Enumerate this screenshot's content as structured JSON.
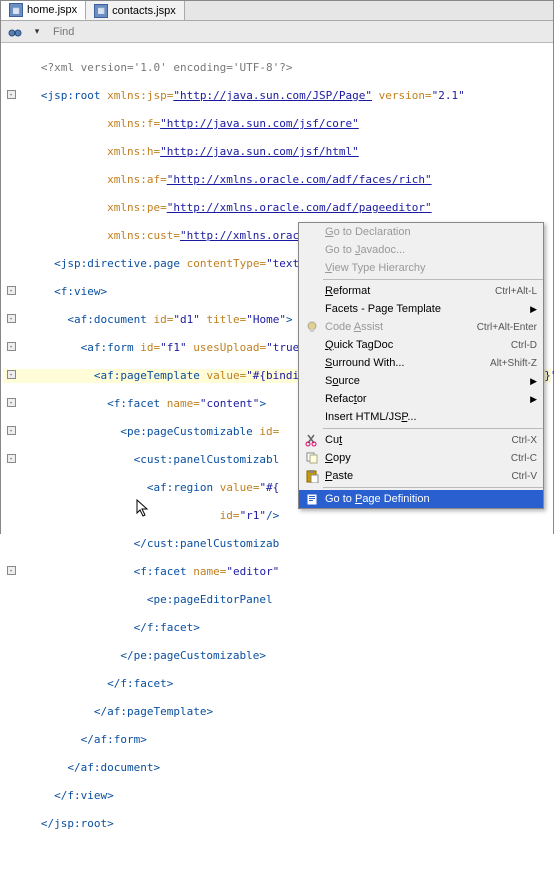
{
  "tabs": {
    "items": [
      "home.jspx",
      "contacts.jspx"
    ],
    "active": 0
  },
  "find": {
    "placeholder": "Find"
  },
  "code": {
    "l1": "<?xml version='1.0' encoding='UTF-8'?>",
    "l2a": "<jsp:root",
    "l2b": " xmlns:jsp=",
    "l2c": "\"http://java.sun.com/JSP/Page\"",
    "l2d": " version=",
    "l2e": "\"2.1\"",
    "l3a": "xmlns:f=",
    "l3b": "\"http://java.sun.com/jsf/core\"",
    "l4a": "xmlns:h=",
    "l4b": "\"http://java.sun.com/jsf/html\"",
    "l5a": "xmlns:af=",
    "l5b": "\"http://xmlns.oracle.com/adf/faces/rich\"",
    "l6a": "xmlns:pe=",
    "l6b": "\"http://xmlns.oracle.com/adf/pageeditor\"",
    "l7a": "xmlns:cust=",
    "l7b": "\"http://xmlns.oracle.com/adf/faces/customizable\"",
    "l7c": ">",
    "l8a": "<jsp:directive.page",
    "l8b": " contentType=",
    "l8c": "\"text/html;charset=UTF-8\"",
    "l8d": "/>",
    "l9": "<f:view>",
    "l10a": "<af:document",
    "l10b": " id=",
    "l10c": "\"d1\"",
    "l10d": " title=",
    "l10e": "\"Home\"",
    "l10f": ">",
    "l11a": "<af:form",
    "l11b": " id=",
    "l11c": "\"f1\"",
    "l11d": " usesUpload=",
    "l11e": "\"true\"",
    "l11f": ">",
    "l12a": "<af:pageTemplate",
    "l12b": " value=",
    "l12c": "\"#{bindings.pageTemplateBinding.templateModel}\"",
    "l13a": "<f:facet",
    "l13b": " name=",
    "l13c": "\"content\"",
    "l13d": ">",
    "l14a": "<pe:pageCustomizable",
    "l14b": " id=",
    "l15a": "<cust:panelCustomizabl",
    "l16a": "<af:region",
    "l16b": " value=",
    "l16c": "\"#{",
    "l17a": "id=",
    "l17b": "\"r1\"",
    "l17c": "/>",
    "l18": "</cust:panelCustomizab",
    "l19a": "<f:facet",
    "l19b": " name=",
    "l19c": "\"editor\"",
    "l20": "<pe:pageEditorPanel",
    "l21": "</f:facet>",
    "l22": "</pe:pageCustomizable>",
    "l23": "</f:facet>",
    "l24": "</af:pageTemplate>",
    "l25": "</af:form>",
    "l26": "</af:document>",
    "l27": "</f:view>",
    "l28": "</jsp:root>"
  },
  "menu": {
    "goDecl": "Go to Declaration",
    "goJavadoc": "Go to Javadoc...",
    "viewType": "View Type Hierarchy",
    "reformat": "Reformat",
    "reformatKey": "Ctrl+Alt-L",
    "facets": "Facets - Page Template",
    "codeAssist": "Code Assist",
    "codeAssistKey": "Ctrl+Alt-Enter",
    "quickTag": "Quick TagDoc",
    "quickTagKey": "Ctrl-D",
    "surround": "Surround With...",
    "surroundKey": "Alt+Shift-Z",
    "source": "Source",
    "refactor": "Refactor",
    "insertHtml": "Insert HTML/JSP...",
    "cut": "Cut",
    "cutKey": "Ctrl-X",
    "copy": "Copy",
    "copyKey": "Ctrl-C",
    "paste": "Paste",
    "pasteKey": "Ctrl-V",
    "goPage": "Go to Page Definition"
  }
}
